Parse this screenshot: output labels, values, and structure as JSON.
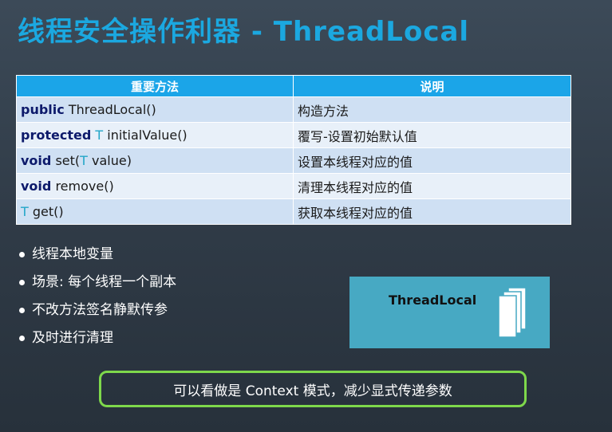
{
  "title": "线程安全操作利器 - ThreadLocal",
  "table": {
    "headers": [
      "重要方法",
      "说明"
    ],
    "rows": [
      {
        "keyword": "public",
        "type": "",
        "signature": "ThreadLocal()",
        "description": "构造方法"
      },
      {
        "keyword": "protected",
        "type": "T",
        "signature": "initialValue()",
        "description": "覆写-设置初始默认值"
      },
      {
        "keyword": "void",
        "type": "",
        "signature": "set(",
        "type2": "T",
        "signature2": "value)",
        "description": "设置本线程对应的值"
      },
      {
        "keyword": "void",
        "type": "",
        "signature": "remove()",
        "description": "清理本线程对应的值"
      },
      {
        "keyword": "",
        "type": "T",
        "signature": "get()",
        "description": "获取本线程对应的值"
      }
    ]
  },
  "bullets": [
    "线程本地变量",
    "场景: 每个线程一个副本",
    "不改方法签名静默传参",
    "及时进行清理"
  ],
  "diagram": {
    "label": "ThreadLocal",
    "icon": "stacked-pages-icon"
  },
  "footer": "可以看做是 Context 模式，减少显式传递参数",
  "colors": {
    "title": "#1ba8e0",
    "header": "#1ba5e8",
    "keyword": "#0d1a6b",
    "type": "#22a6c8",
    "box": "#47a9c3",
    "footer_border": "#7ed84b"
  }
}
